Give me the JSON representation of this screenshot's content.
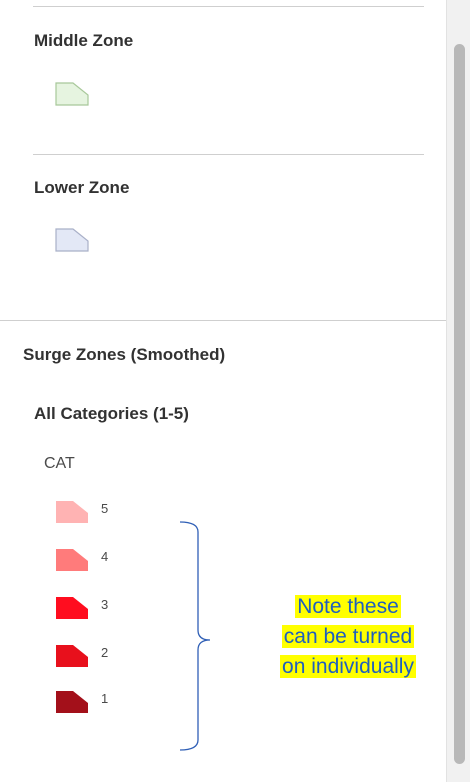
{
  "legend": {
    "middle_zone": {
      "label": "Middle Zone",
      "fill": "#e6f4e0",
      "stroke": "#a8c89a"
    },
    "lower_zone": {
      "label": "Lower Zone",
      "fill": "#e3e8f6",
      "stroke": "#a9b0c8"
    },
    "surge_title": "Surge Zones (Smoothed)",
    "all_categories": "All Categories (1-5)",
    "field_label": "CAT",
    "categories": [
      {
        "label": "5",
        "fill": "#ffb3b3"
      },
      {
        "label": "4",
        "fill": "#ff7b7b"
      },
      {
        "label": "3",
        "fill": "#ff0d1f"
      },
      {
        "label": "2",
        "fill": "#e8101c"
      },
      {
        "label": "1",
        "fill": "#a3101a"
      }
    ]
  },
  "annotation": {
    "lines": [
      "Note these",
      "can be turned",
      "on individually"
    ],
    "text_color": "#1f5fbf",
    "highlight_color": "#ffff00"
  }
}
